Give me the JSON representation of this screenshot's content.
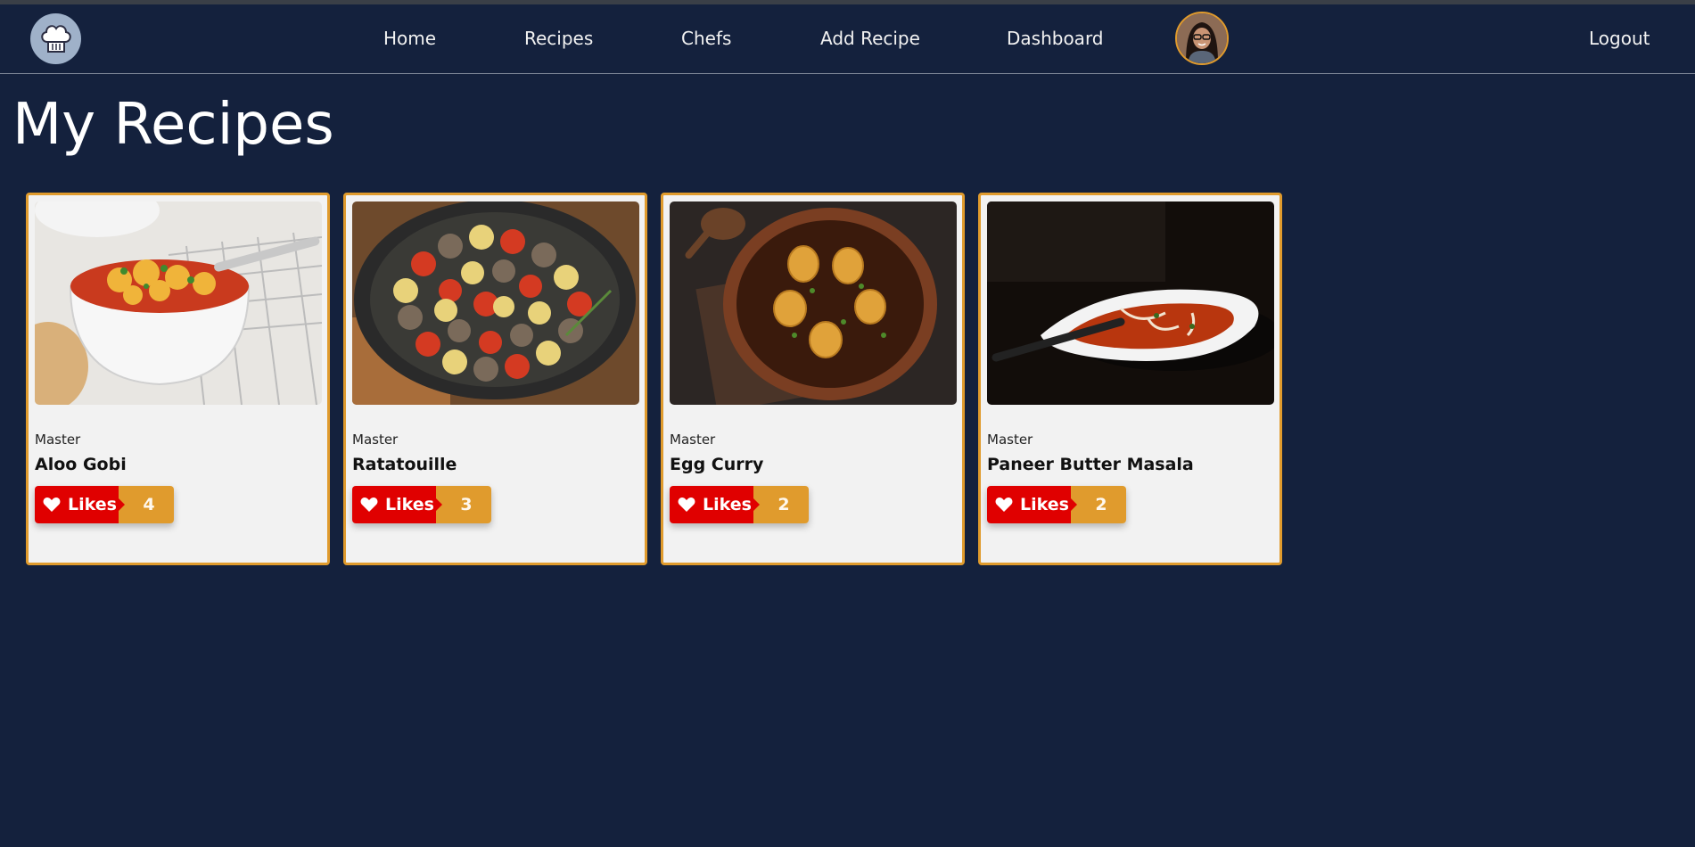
{
  "nav": {
    "logo_icon": "chef-hat-icon",
    "links": [
      "Home",
      "Recipes",
      "Chefs",
      "Add Recipe",
      "Dashboard"
    ],
    "logout": "Logout",
    "avatar_icon": "user-avatar"
  },
  "page": {
    "title": "My Recipes"
  },
  "recipes": [
    {
      "category": "Master",
      "title": "Aloo Gobi",
      "likes_label": "Likes",
      "likes": "4"
    },
    {
      "category": "Master",
      "title": "Ratatouille",
      "likes_label": "Likes",
      "likes": "3"
    },
    {
      "category": "Master",
      "title": "Egg Curry",
      "likes_label": "Likes",
      "likes": "2"
    },
    {
      "category": "Master",
      "title": "Paneer Butter Masala",
      "likes_label": "Likes",
      "likes": "2"
    }
  ],
  "colors": {
    "background": "#14213d",
    "accent": "#e09b2d",
    "like_red": "#e00000",
    "card_bg": "#f2f2f2"
  }
}
